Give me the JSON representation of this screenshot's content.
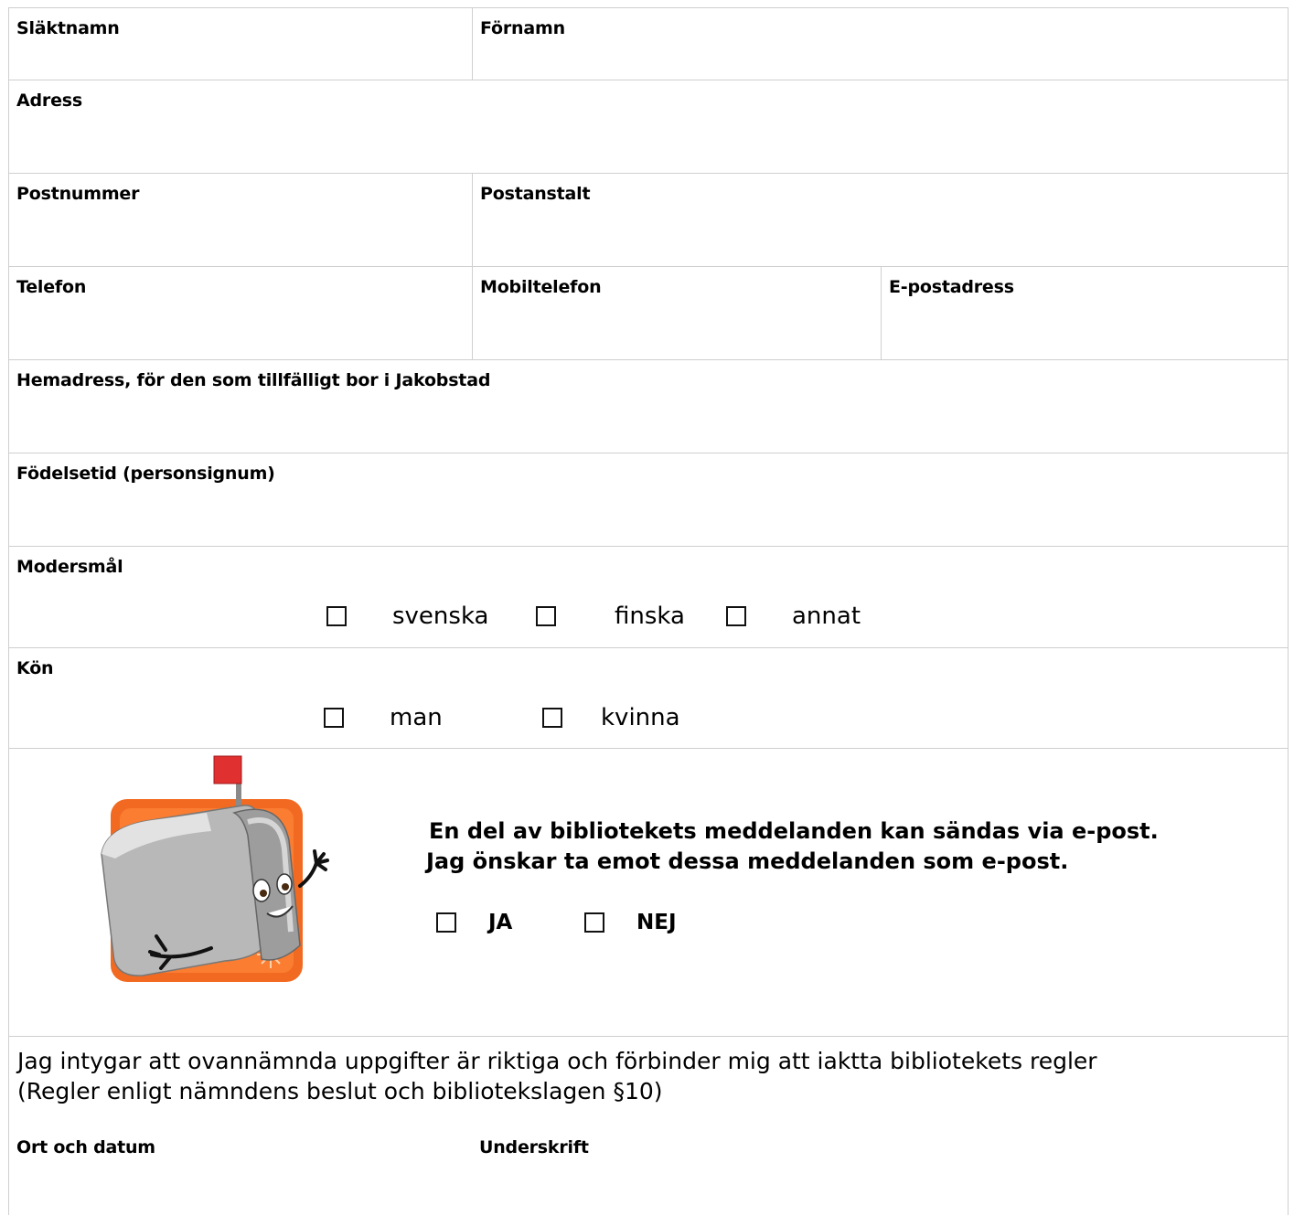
{
  "fields": {
    "slaktnamn": "Släktnamn",
    "fornamn": "Förnamn",
    "adress": "Adress",
    "postnummer": "Postnummer",
    "postanstalt": "Postanstalt",
    "telefon": "Telefon",
    "mobiltelefon": "Mobiltelefon",
    "epostadress": "E-postadress",
    "hemadress": "Hemadress, för den som tillfälligt bor i Jakobstad",
    "fodelsetid": "Födelsetid (personsignum)"
  },
  "modersmal": {
    "label": "Modersmål",
    "options": [
      "svenska",
      "finska",
      "annat"
    ]
  },
  "kon": {
    "label": "Kön",
    "options": [
      "man",
      "kvinna"
    ]
  },
  "email_notice": {
    "line1": "En del av bibliotekets meddelanden kan sändas via e-post.",
    "line2": "Jag önskar ta emot dessa meddelanden som e-post.",
    "yes": "JA",
    "no": "NEJ",
    "icon": "mailbox-mascot-icon",
    "colors": {
      "frame": "#f26a21",
      "flag": "#e03030",
      "box": "#b8b8b8"
    }
  },
  "certification": {
    "line1": "Jag intygar att ovannämnda uppgifter är riktiga och förbinder mig att iaktta bibliotekets regler",
    "line2": "(Regler enligt nämndens beslut och bibliotekslagen §10)",
    "ort_datum": "Ort och datum",
    "underskrift": "Underskrift"
  }
}
